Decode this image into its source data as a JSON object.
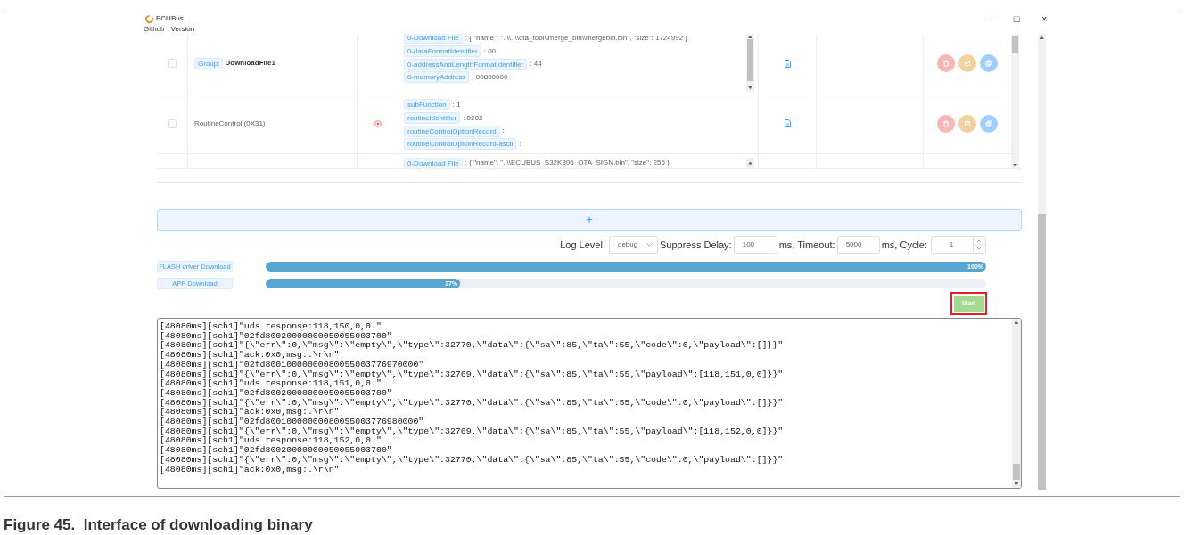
{
  "window": {
    "title": "ECUBus",
    "controls": [
      "–",
      "□",
      "×"
    ]
  },
  "menu": [
    {
      "label": "Github"
    },
    {
      "label": "Version"
    }
  ],
  "table": {
    "rows": [
      {
        "kind": "group",
        "checked": false,
        "tag": "Group:",
        "name": "DownloadFile1",
        "failed": false,
        "has_file": true,
        "params": [
          {
            "key": "0-Download File",
            "value": ": { \"name\": \"..\\\\..\\\\ota_tool\\\\merge_bin\\\\mergebin.bin\", \"size\": 1724992 }"
          },
          {
            "key": "0-dataFormatIdentifier",
            "value": ": 00"
          },
          {
            "key": "0-addressAndLengthFormatIdentifier",
            "value": ": 44"
          },
          {
            "key": "0-memoryAddress",
            "value": ": 00800000"
          }
        ]
      },
      {
        "kind": "service",
        "checked": false,
        "name": "RoutineControl (0X31)",
        "failed": true,
        "has_file": true,
        "params": [
          {
            "key": "subFunction",
            "value": ": 1"
          },
          {
            "key": "routineIdentifier",
            "value": ": 0202"
          },
          {
            "key": "routineControlOptionRecord",
            "value": ":"
          },
          {
            "key": "routineControlOptionRecord-ascii",
            "value": ":"
          }
        ]
      },
      {
        "kind": "partial",
        "params": [
          {
            "key": "0-Download File",
            "value": ": { \"name\": \"..\\\\ECUBUS_S32K396_OTA_SIGN.bin\", \"size\": 256 }"
          }
        ]
      }
    ]
  },
  "add_button": {
    "label": "+"
  },
  "settings": {
    "log_level_label": "Log Level:",
    "log_level": "debug",
    "suppress_label": "Suppress Delay:",
    "suppress": "100",
    "timeout_label": "ms, Timeout:",
    "timeout": "5000",
    "cycle_label": "ms, Cycle:",
    "cycle": "1"
  },
  "progress": [
    {
      "label": "FLASH driver Download",
      "level": 1,
      "reading": "100%"
    },
    {
      "label": "APP Download",
      "level": 0.27,
      "reading": "27%"
    }
  ],
  "start_button": {
    "label": "Start",
    "highlighted": true
  },
  "log": [
    "[48080ms][sch1]\"uds response:118,150,0,0.\"",
    "[48080ms][sch1]\"02fd80020000000050055003700\"",
    "[48080ms][sch1]\"{\\\"err\\\":0,\\\"msg\\\":\\\"empty\\\",\\\"type\\\":32770,\\\"data\\\":{\\\"sa\\\":85,\\\"ta\\\":55,\\\"code\\\":0,\\\"payload\\\":[]}}\"",
    "[48080ms][sch1]\"ack:0x0,msg:.\\r\\n\"",
    "[48080ms][sch1]\"02fd80010000000080055003776970000\"",
    "[48080ms][sch1]\"{\\\"err\\\":0,\\\"msg\\\":\\\"empty\\\",\\\"type\\\":32769,\\\"data\\\":{\\\"sa\\\":85,\\\"ta\\\":55,\\\"payload\\\":[118,151,0,0]}}\"",
    "[48080ms][sch1]\"uds response:118,151,0,0.\"",
    "[48080ms][sch1]\"02fd80020000000050055003700\"",
    "[48080ms][sch1]\"{\\\"err\\\":0,\\\"msg\\\":\\\"empty\\\",\\\"type\\\":32770,\\\"data\\\":{\\\"sa\\\":85,\\\"ta\\\":55,\\\"code\\\":0,\\\"payload\\\":[]}}\"",
    "[48080ms][sch1]\"ack:0x0,msg:.\\r\\n\"",
    "[48080ms][sch1]\"02fd80010000000080055003776980000\"",
    "[48080ms][sch1]\"{\\\"err\\\":0,\\\"msg\\\":\\\"empty\\\",\\\"type\\\":32769,\\\"data\\\":{\\\"sa\\\":85,\\\"ta\\\":55,\\\"payload\\\":[118,152,0,0]}}\"",
    "[48080ms][sch1]\"uds response:118,152,0,0.\"",
    "[48080ms][sch1]\"02fd80020000000050055003700\"",
    "[48080ms][sch1]\"{\\\"err\\\":0,\\\"msg\\\":\\\"empty\\\",\\\"type\\\":32770,\\\"data\\\":{\\\"sa\\\":85,\\\"ta\\\":55,\\\"code\\\":0,\\\"payload\\\":[]}}\"",
    "[48080ms][sch1]\"ack:0x0,msg:.\\r\\n\""
  ],
  "caption": "Figure 45.  Interface of downloading binary"
}
